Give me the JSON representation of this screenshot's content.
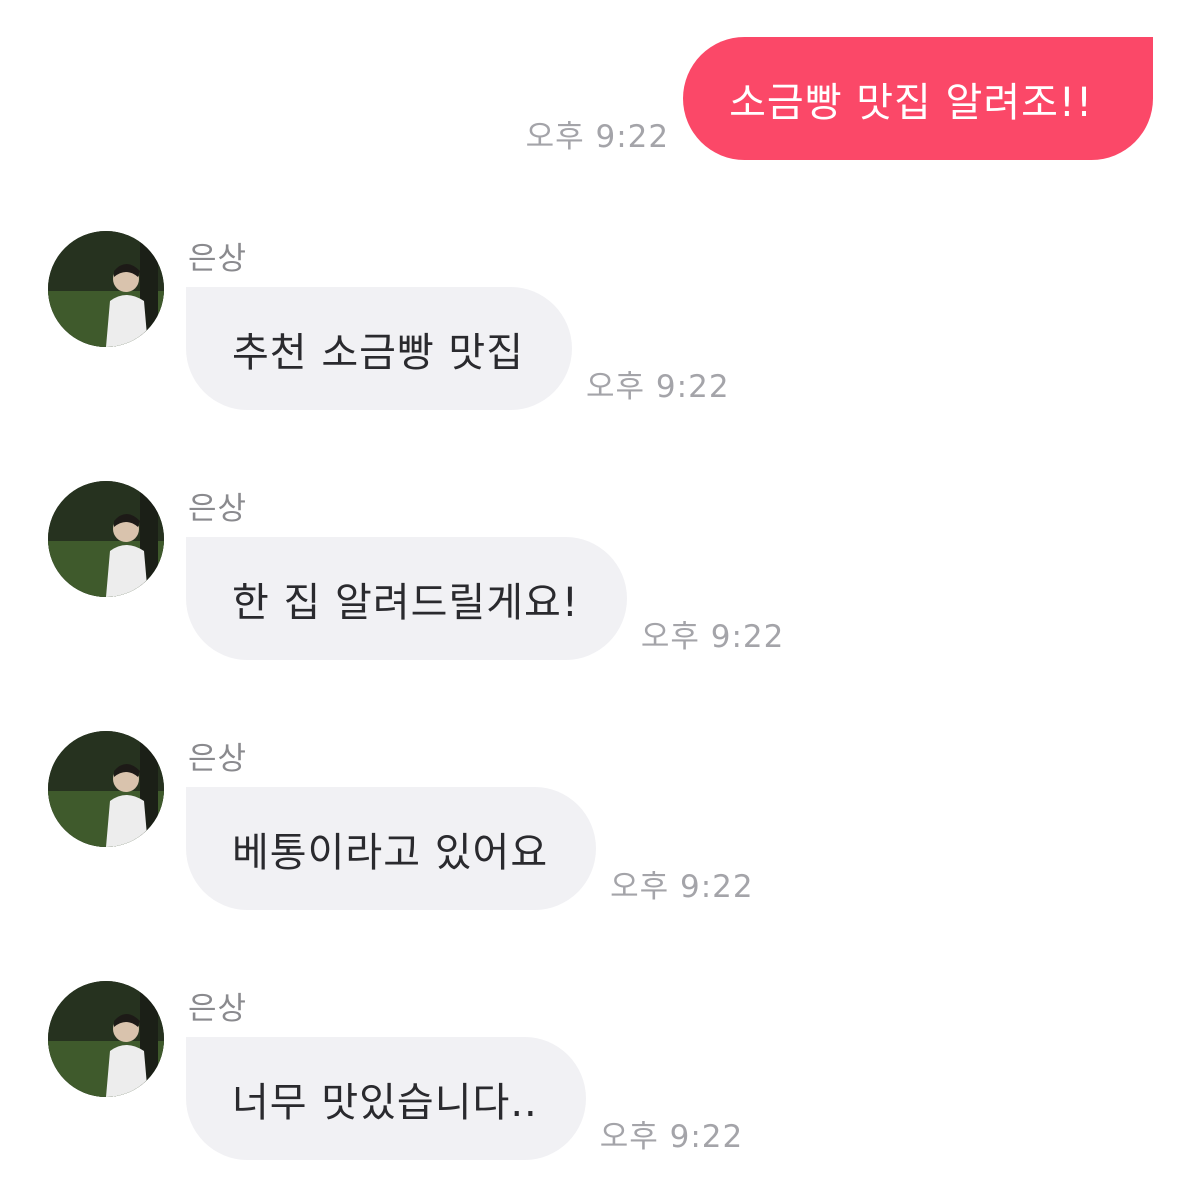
{
  "sent_message": {
    "text": "소금빵 맛집 알려조!!",
    "time": "오후 9:22",
    "color": "#fb4868"
  },
  "received_messages": [
    {
      "sender": "은상",
      "text": "추천 소금빵 맛집",
      "time": "오후 9:22"
    },
    {
      "sender": "은상",
      "text": "한 집 알려드릴게요!",
      "time": "오후 9:22"
    },
    {
      "sender": "은상",
      "text": "베통이라고 있어요",
      "time": "오후 9:22"
    },
    {
      "sender": "은상",
      "text": "너무 맛있습니다..",
      "time": "오후 9:22"
    }
  ],
  "colors": {
    "sent_bubble": "#fb4868",
    "received_bubble": "#f1f1f4",
    "timestamp": "#a4a4a9"
  }
}
